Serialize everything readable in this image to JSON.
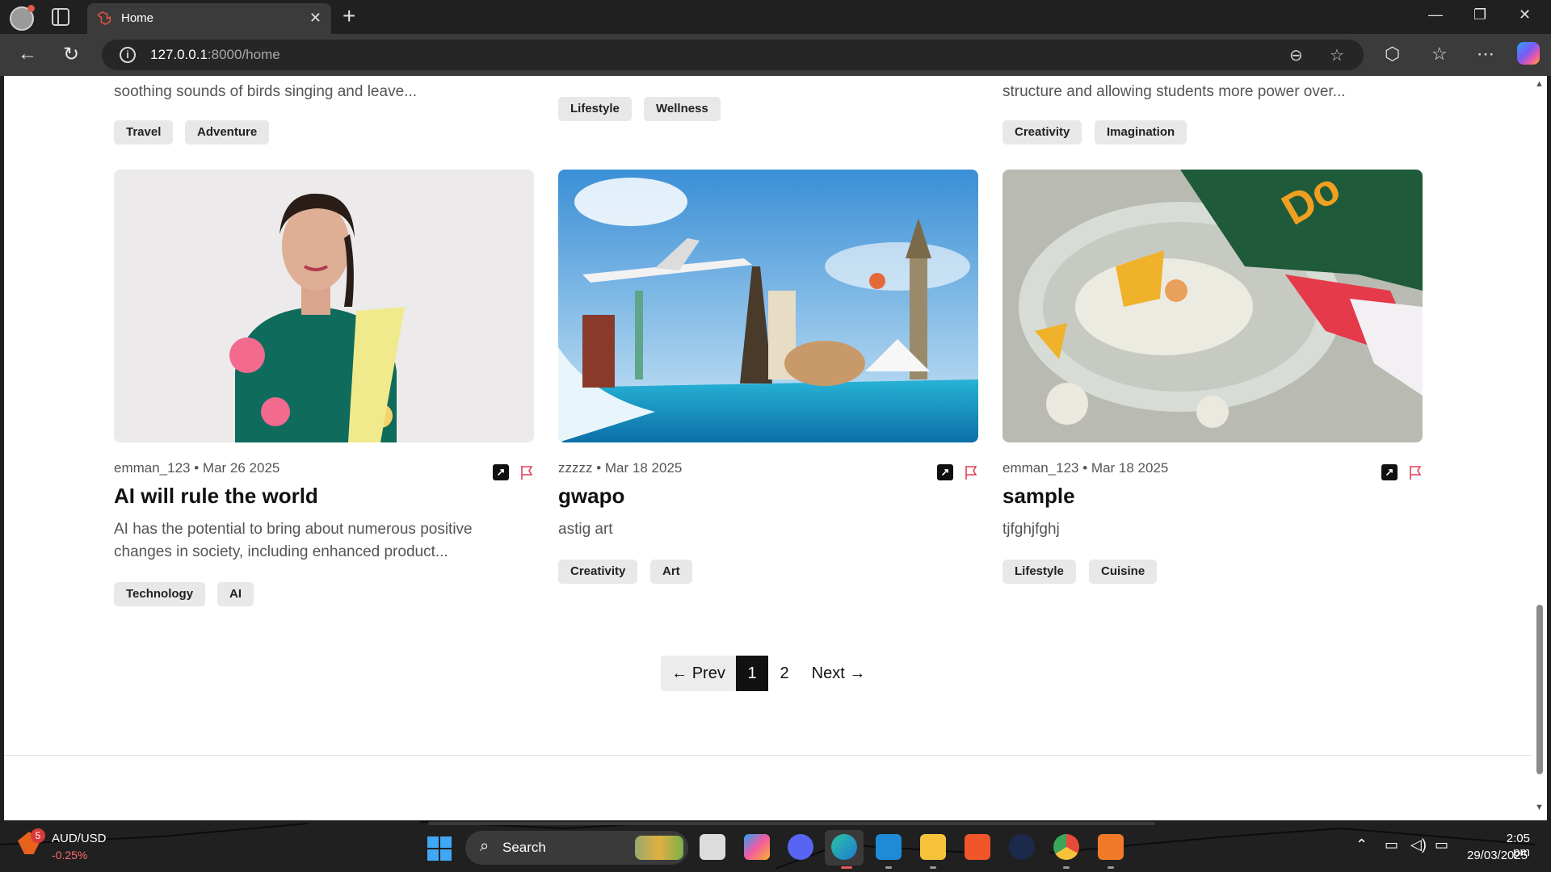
{
  "browser": {
    "tab_title": "Home",
    "url_host": "127.0.0.1",
    "url_path": ":8000/home",
    "icons": [
      "profile-icon",
      "tab-actions-icon",
      "laravel-icon",
      "close-icon",
      "new-tab-icon",
      "minimize-icon",
      "restore-icon",
      "window-close-icon",
      "back-icon",
      "refresh-icon",
      "info-icon",
      "reading-mode-icon",
      "favorite-star-icon",
      "extensions-icon",
      "favorites-icon",
      "more-icon",
      "copilot-icon"
    ]
  },
  "top_row": [
    {
      "snippet": "soothing sounds of birds singing and leave...",
      "tags": [
        "Travel",
        "Adventure"
      ]
    },
    {
      "snippet": "",
      "tags": [
        "Lifestyle",
        "Wellness"
      ]
    },
    {
      "snippet": "structure and allowing students more power over...",
      "tags": [
        "Creativity",
        "Imagination"
      ]
    }
  ],
  "posts": [
    {
      "meta": "emman_123 • Mar 26 2025",
      "title": "AI will rule the world",
      "excerpt_line1": "AI has the potential to bring about numerous positive",
      "excerpt_line2": "changes in society, including enhanced product...",
      "tags": [
        "Technology",
        "AI"
      ],
      "image": "portrait-photo"
    },
    {
      "meta": "zzzzz • Mar 18 2025",
      "title": "gwapo",
      "excerpt_line1": "astig art",
      "excerpt_line2": "",
      "tags": [
        "Creativity",
        "Art"
      ],
      "image": "travel-landmarks-photo"
    },
    {
      "meta": "emman_123 • Mar 18 2025",
      "title": "sample",
      "excerpt_line1": "tjfghjfghj",
      "excerpt_line2": "",
      "tags": [
        "Lifestyle",
        "Cuisine"
      ],
      "image": "food-bowl-photo"
    }
  ],
  "pagination": {
    "prev": "← Prev",
    "pages": [
      "1",
      "2"
    ],
    "current": "1",
    "next": "Next →"
  },
  "taskbar": {
    "ticker_name": "AUD/USD",
    "ticker_change": "-0.25%",
    "ticker_badge": "5",
    "search_label": "Search",
    "time": "2:05 pm",
    "date": "29/03/2025",
    "apps": [
      "start-icon",
      "task-view-icon",
      "copilot-app-icon",
      "discord-icon",
      "edge-icon",
      "vscode-icon",
      "file-explorer-icon",
      "brave-icon",
      "steam-icon",
      "chrome-icon",
      "xampp-icon"
    ],
    "tray": [
      "chevron-up-icon",
      "display-icon",
      "volume-icon",
      "battery-icon"
    ]
  },
  "colors": {
    "accent_flag": "#e0405a",
    "pager_active": "#111111",
    "tag_bg": "#e8e8e8",
    "chrome_dark": "#202020"
  }
}
